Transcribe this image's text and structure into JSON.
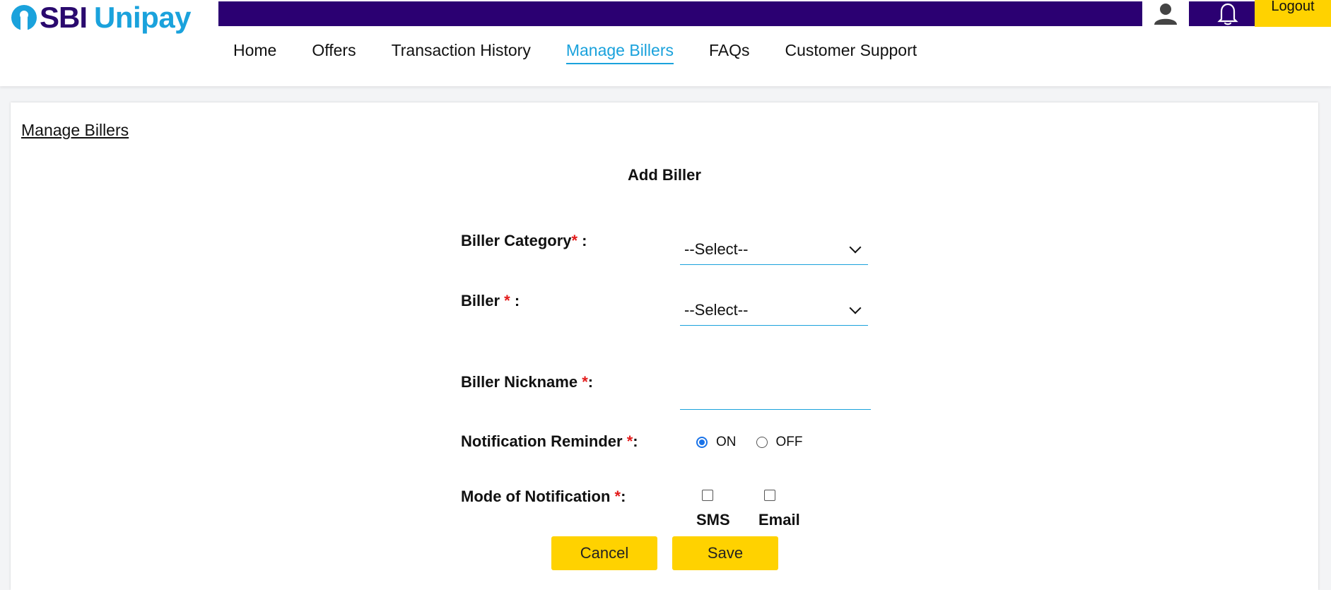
{
  "brand": {
    "sbi": "SBI",
    "unipay": "Unipay",
    "primary_color": "#2b0072",
    "accent_color": "#1aa2dc",
    "button_color": "#ffd200"
  },
  "topbar": {
    "user_icon": "user-icon",
    "bell_icon": "bell-icon",
    "logout_label": "Logout"
  },
  "nav": {
    "items": [
      {
        "label": "Home"
      },
      {
        "label": "Offers"
      },
      {
        "label": "Transaction History"
      },
      {
        "label": "Manage Billers",
        "active": true
      },
      {
        "label": "FAQs"
      },
      {
        "label": "Customer Support"
      }
    ]
  },
  "page": {
    "title": "Manage Billers",
    "form_title": "Add Biller"
  },
  "form": {
    "biller_category": {
      "label": "Biller Category",
      "required_mark": "*",
      "suffix": " :",
      "value": "--Select--"
    },
    "biller": {
      "label": "Biller ",
      "required_mark": "*",
      "suffix": " :",
      "value": "--Select--"
    },
    "biller_nickname": {
      "label": "Biller Nickname ",
      "required_mark": "*",
      "suffix": ":",
      "value": "",
      "placeholder": ""
    },
    "notification_reminder": {
      "label": "Notification Reminder ",
      "required_mark": "*",
      "suffix": ":",
      "options": [
        "ON",
        "OFF"
      ],
      "selected": "ON"
    },
    "mode_of_notification": {
      "label": "Mode of Notification ",
      "required_mark": "*",
      "suffix": ":",
      "options": [
        "SMS",
        "Email"
      ]
    }
  },
  "actions": {
    "cancel_label": "Cancel",
    "save_label": "Save"
  }
}
